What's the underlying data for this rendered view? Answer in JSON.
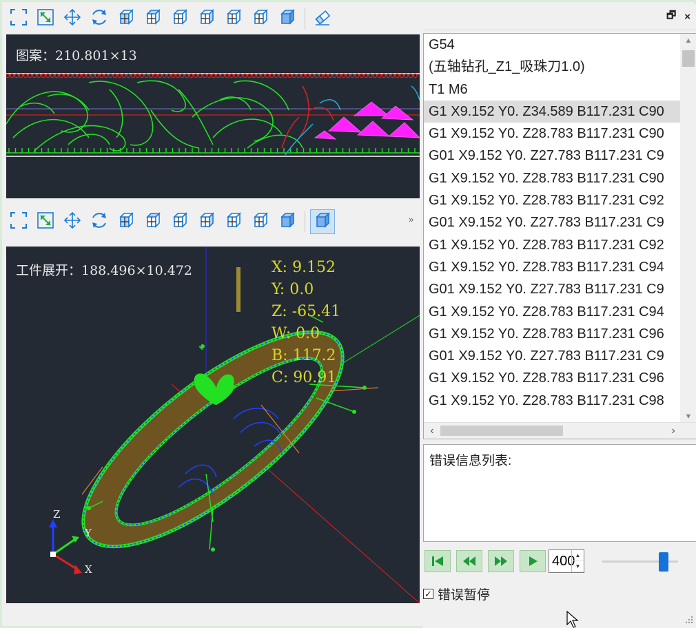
{
  "top_view": {
    "label": "图案：210.801×13"
  },
  "bottom_view": {
    "label": "工件展开：188.496×10.472",
    "coords": [
      {
        "text": "X: 9.152"
      },
      {
        "text": "Y: 0.0"
      },
      {
        "text": "Z: -65.41"
      },
      {
        "text": "W: 0.0"
      },
      {
        "text": "B: 117.2"
      },
      {
        "text": "C: 90.91"
      }
    ],
    "axis_labels": {
      "z": "Z",
      "y": "Y",
      "x": "X"
    }
  },
  "toolbar_icons": [
    "zoom-extents-icon",
    "zoom-window-icon",
    "pan-icon",
    "rotate-icon",
    "view-front-icon",
    "view-top-icon",
    "view-left-icon",
    "view-right-icon",
    "view-back-icon",
    "view-bottom-icon",
    "view-iso-icon",
    "eraser-icon"
  ],
  "toolbar2_icons": [
    "zoom-extents-icon",
    "zoom-window-icon",
    "pan-icon",
    "rotate-icon",
    "view-front-icon",
    "view-top-icon",
    "view-left-icon",
    "view-right-icon",
    "view-back-icon",
    "view-bottom-icon",
    "view-iso-icon",
    "solid-view-icon"
  ],
  "toolbar2_overflow": "»",
  "panel": {
    "restore_glyph": "🗗",
    "close_glyph": "×"
  },
  "code_lines": [
    "G54",
    "(五轴钻孔_Z1_吸珠刀1.0)",
    "T1 M6",
    "G1 X9.152 Y0. Z34.589 B117.231 C90",
    "G1 X9.152 Y0. Z28.783 B117.231 C90",
    "G01 X9.152 Y0. Z27.783 B117.231 C9",
    "G1 X9.152 Y0. Z28.783 B117.231 C90",
    "G1 X9.152 Y0. Z28.783 B117.231 C92",
    "G01 X9.152 Y0. Z27.783 B117.231 C9",
    "G1 X9.152 Y0. Z28.783 B117.231 C92",
    "G1 X9.152 Y0. Z28.783 B117.231 C94",
    "G01 X9.152 Y0. Z27.783 B117.231 C9",
    "G1 X9.152 Y0. Z28.783 B117.231 C94",
    "G1 X9.152 Y0. Z28.783 B117.231 C96",
    "G01 X9.152 Y0. Z27.783 B117.231 C9",
    "G1 X9.152 Y0. Z28.783 B117.231 C96",
    "G1 X9.152 Y0. Z28.783 B117.231 C98"
  ],
  "selected_line_index": 3,
  "error_box": {
    "title": "错误信息列表:"
  },
  "controls": {
    "speed_value": "400",
    "slider_level": 0.85
  },
  "checkbox": {
    "label": "错误暂停",
    "checked": true
  },
  "colors": {
    "viewport_bg": "#242a33",
    "pattern_green": "#22e022",
    "pattern_magenta": "#ff22ff",
    "coord_yellow": "#d6d62a",
    "ring_tan": "#8a6a28"
  }
}
